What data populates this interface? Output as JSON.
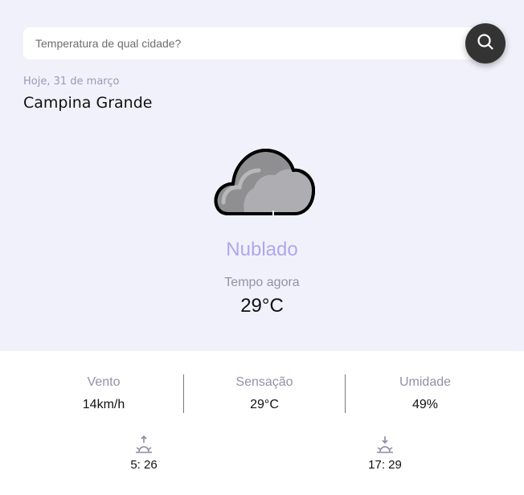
{
  "search": {
    "placeholder": "Temperatura de qual cidade?"
  },
  "location": {
    "date": "Hoje, 31 de março",
    "city": "Campina Grande"
  },
  "weather": {
    "icon": "cloud-icon",
    "condition": "Nublado",
    "now_label": "Tempo agora",
    "temperature": "29°C"
  },
  "stats": {
    "wind": {
      "label": "Vento",
      "value": "14km/h"
    },
    "feels_like": {
      "label": "Sensação",
      "value": "29°C"
    },
    "humidity": {
      "label": "Umidade",
      "value": "49%"
    }
  },
  "sun": {
    "sunrise": {
      "icon": "sunrise-icon",
      "time": "5: 26"
    },
    "sunset": {
      "icon": "sunset-icon",
      "time": "17: 29"
    }
  },
  "colors": {
    "background_top": "#f1f1fb",
    "accent": "#b2a5f0",
    "muted": "#9291a8",
    "button": "#333333"
  }
}
